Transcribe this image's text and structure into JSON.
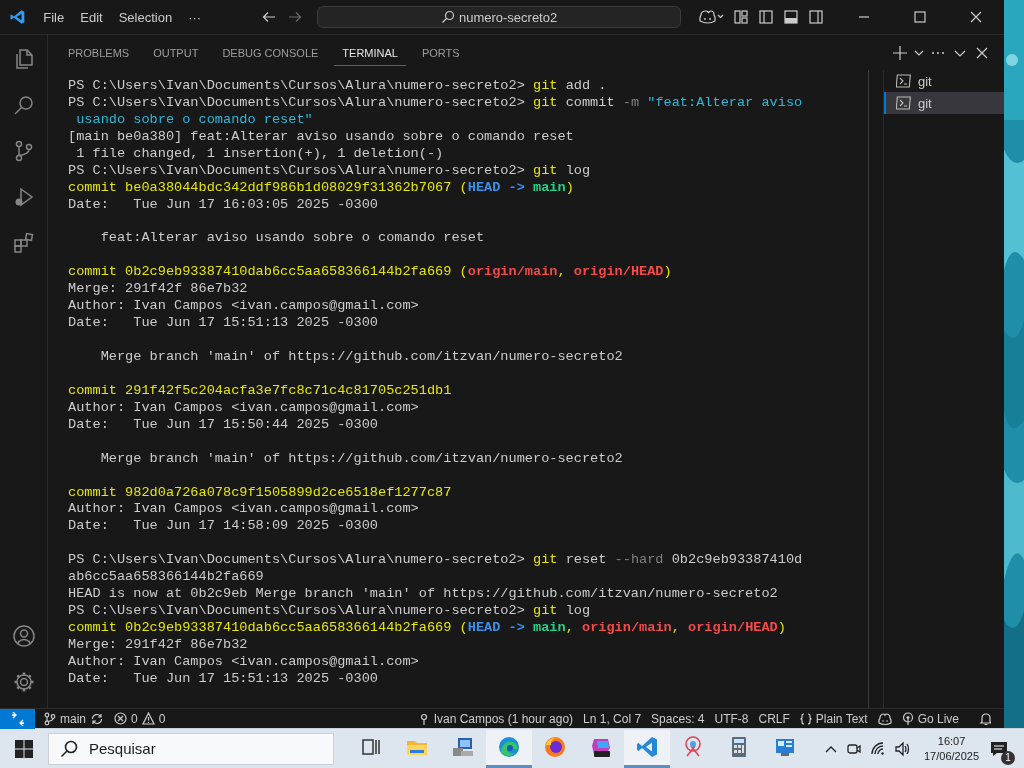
{
  "title_bar": {
    "menu": [
      "File",
      "Edit",
      "Selection",
      "···"
    ],
    "search": "numero-secreto2"
  },
  "panel": {
    "tabs": [
      {
        "label": "PROBLEMS",
        "selected": false
      },
      {
        "label": "OUTPUT",
        "selected": false
      },
      {
        "label": "DEBUG CONSOLE",
        "selected": false
      },
      {
        "label": "TERMINAL",
        "selected": true
      },
      {
        "label": "PORTS",
        "selected": false
      }
    ]
  },
  "terminal": {
    "blocks": [
      {
        "lines": [
          {
            "spans": [
              {
                "kind": "plain",
                "text": "PS C:\\Users\\Ivan\\Documents\\Cursos\\Alura\\numero-secreto2> "
              },
              {
                "kind": "cmd",
                "text": "git"
              },
              {
                "kind": "plain",
                "text": " add ."
              }
            ]
          },
          {
            "spans": [
              {
                "kind": "plain",
                "text": "PS C:\\Users\\Ivan\\Documents\\Cursos\\Alura\\numero-secreto2> "
              },
              {
                "kind": "cmd",
                "text": "git"
              },
              {
                "kind": "plain",
                "text": " commit "
              },
              {
                "kind": "flag",
                "text": "-m"
              },
              {
                "kind": "string",
                "text": " \"feat:Alterar aviso"
              }
            ]
          },
          {
            "spans": [
              {
                "kind": "string",
                "text": " usando sobre o comando reset\""
              }
            ]
          },
          {
            "spans": [
              {
                "kind": "plain",
                "text": "[main be0a380] feat:Alterar aviso usando sobre o comando reset"
              }
            ]
          },
          {
            "spans": [
              {
                "kind": "plain",
                "text": " 1 file changed, 1 insertion(+), 1 deletion(-)"
              }
            ]
          },
          {
            "spans": [
              {
                "kind": "plain",
                "text": "PS C:\\Users\\Ivan\\Documents\\Cursos\\Alura\\numero-secreto2> "
              },
              {
                "kind": "cmd",
                "text": "git"
              },
              {
                "kind": "plain",
                "text": " log"
              }
            ]
          },
          {
            "spans": [
              {
                "kind": "hash",
                "text": "commit be0a38044bdc342ddf986b1d08029f31362b7067 ("
              },
              {
                "kind": "head",
                "text": "HEAD -> "
              },
              {
                "kind": "branch",
                "text": "main"
              },
              {
                "kind": "hash",
                "text": ")"
              }
            ]
          },
          {
            "spans": [
              {
                "kind": "plain",
                "text": "Date:   Tue Jun 17 16:03:05 2025 -0300"
              }
            ]
          }
        ]
      },
      {
        "lines": [
          {
            "spans": [
              {
                "kind": "plain",
                "text": "    feat:Alterar aviso usando sobre o comando reset"
              }
            ]
          }
        ]
      },
      {
        "lines": [
          {
            "spans": [
              {
                "kind": "hash",
                "text": "commit 0b2c9eb93387410dab6cc5aa658366144b2fa669 ("
              },
              {
                "kind": "remote",
                "text": "origin/main"
              },
              {
                "kind": "hash",
                "text": ", "
              },
              {
                "kind": "remote",
                "text": "origin/HEAD"
              },
              {
                "kind": "hash",
                "text": ")"
              }
            ]
          },
          {
            "spans": [
              {
                "kind": "plain",
                "text": "Merge: 291f42f 86e7b32"
              }
            ]
          },
          {
            "spans": [
              {
                "kind": "plain",
                "text": "Author: Ivan Campos <ivan.campos@gmail.com>"
              }
            ]
          },
          {
            "spans": [
              {
                "kind": "plain",
                "text": "Date:   Tue Jun 17 15:51:13 2025 -0300"
              }
            ]
          }
        ]
      },
      {
        "lines": [
          {
            "spans": [
              {
                "kind": "plain",
                "text": "    Merge branch 'main' of https://github.com/itzvan/numero-secreto2"
              }
            ]
          }
        ]
      },
      {
        "lines": [
          {
            "spans": [
              {
                "kind": "hash",
                "text": "commit 291f42f5c204acfa3e7fc8c71c4c81705c251db1"
              }
            ]
          },
          {
            "spans": [
              {
                "kind": "plain",
                "text": "Author: Ivan Campos <ivan.campos@gmail.com>"
              }
            ]
          },
          {
            "spans": [
              {
                "kind": "plain",
                "text": "Date:   Tue Jun 17 15:50:44 2025 -0300"
              }
            ]
          }
        ]
      },
      {
        "lines": [
          {
            "spans": [
              {
                "kind": "plain",
                "text": "    Merge branch 'main' of https://github.com/itzvan/numero-secreto2"
              }
            ]
          }
        ]
      },
      {
        "lines": [
          {
            "spans": [
              {
                "kind": "hash",
                "text": "commit 982d0a726a078c9f1505899d2ce6518ef1277c87"
              }
            ]
          },
          {
            "spans": [
              {
                "kind": "plain",
                "text": "Author: Ivan Campos <ivan.campos@gmail.com>"
              }
            ]
          },
          {
            "spans": [
              {
                "kind": "plain",
                "text": "Date:   Tue Jun 17 14:58:09 2025 -0300"
              }
            ]
          }
        ]
      },
      {
        "lines": [
          {
            "spans": [
              {
                "kind": "plain",
                "text": "PS C:\\Users\\Ivan\\Documents\\Cursos\\Alura\\numero-secreto2> "
              },
              {
                "kind": "cmd",
                "text": "git"
              },
              {
                "kind": "plain",
                "text": " reset "
              },
              {
                "kind": "flag",
                "text": "--hard"
              },
              {
                "kind": "plain",
                "text": " 0b2c9eb93387410d"
              }
            ]
          },
          {
            "spans": [
              {
                "kind": "plain",
                "text": "ab6cc5aa658366144b2fa669"
              }
            ]
          },
          {
            "spans": [
              {
                "kind": "plain",
                "text": "HEAD is now at 0b2c9eb Merge branch 'main' of https://github.com/itzvan/numero-secreto2"
              }
            ]
          },
          {
            "spans": [
              {
                "kind": "plain",
                "text": "PS C:\\Users\\Ivan\\Documents\\Cursos\\Alura\\numero-secreto2> "
              },
              {
                "kind": "cmd",
                "text": "git"
              },
              {
                "kind": "plain",
                "text": " log"
              }
            ]
          },
          {
            "spans": [
              {
                "kind": "hash",
                "text": "commit 0b2c9eb93387410dab6cc5aa658366144b2fa669 ("
              },
              {
                "kind": "head",
                "text": "HEAD -> "
              },
              {
                "kind": "branch",
                "text": "main"
              },
              {
                "kind": "hash",
                "text": ", "
              },
              {
                "kind": "remote",
                "text": "origin/main"
              },
              {
                "kind": "hash",
                "text": ", "
              },
              {
                "kind": "remote",
                "text": "origin/HEAD"
              },
              {
                "kind": "hash",
                "text": ")"
              }
            ]
          },
          {
            "spans": [
              {
                "kind": "plain",
                "text": "Merge: 291f42f 86e7b32"
              }
            ]
          },
          {
            "spans": [
              {
                "kind": "plain",
                "text": "Author: Ivan Campos <ivan.campos@gmail.com>"
              }
            ]
          },
          {
            "spans": [
              {
                "kind": "plain",
                "text": "Date:   Tue Jun 17 15:51:13 2025 -0300"
              }
            ]
          }
        ]
      }
    ]
  },
  "terminal_list": [
    {
      "label": "git",
      "selected": false
    },
    {
      "label": "git",
      "selected": true
    }
  ],
  "status_bar": {
    "branch": "main",
    "errors": "0",
    "warnings": "0",
    "items": [
      {
        "kind": "blame",
        "text": "Ivan Campos (1 hour ago)"
      },
      {
        "kind": "plain",
        "text": "Ln 1, Col 7"
      },
      {
        "kind": "plain",
        "text": "Spaces: 4"
      },
      {
        "kind": "plain",
        "text": "UTF-8"
      },
      {
        "kind": "plain",
        "text": "CRLF"
      },
      {
        "kind": "language",
        "text": "Plain Text"
      },
      {
        "kind": "copilot"
      },
      {
        "kind": "live",
        "text": "Go Live"
      },
      {
        "kind": "bell"
      }
    ]
  },
  "taskbar": {
    "search": {
      "placeholder": "Pesquisar"
    },
    "apps": [
      {
        "kind": "taskview",
        "running": false
      },
      {
        "kind": "folder",
        "running": false
      },
      {
        "kind": "computer",
        "running": false
      },
      {
        "kind": "edge",
        "running": true
      },
      {
        "kind": "firefox",
        "running": false
      },
      {
        "kind": "office",
        "running": false
      },
      {
        "kind": "vscode",
        "running": true
      },
      {
        "kind": "snip",
        "running": false
      },
      {
        "kind": "calculator",
        "running": false
      },
      {
        "kind": "panel",
        "running": false
      }
    ],
    "time": "16:07",
    "date": "17/06/2025",
    "notifications": "1"
  }
}
